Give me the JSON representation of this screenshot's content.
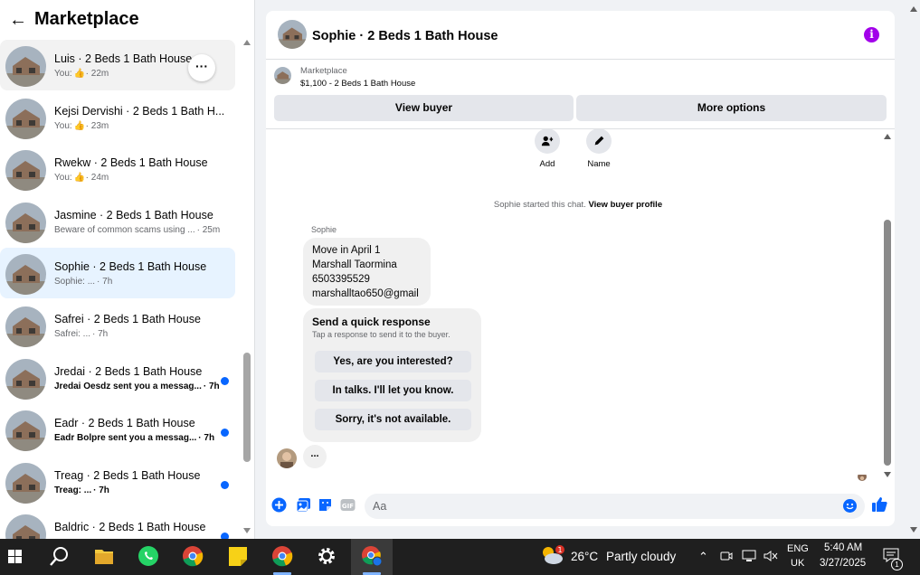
{
  "sidebar": {
    "title": "Marketplace",
    "conversations": [
      {
        "title": "Luis · 2 Beds 1 Bath House",
        "prefix": "You:",
        "thumb": true,
        "time": "· 22m",
        "state": "hover",
        "unread": false
      },
      {
        "title": "Kejsi Dervishi · 2 Beds 1 Bath H...",
        "prefix": "You:",
        "thumb": true,
        "time": "· 23m",
        "state": "",
        "unread": false
      },
      {
        "title": "Rwekw · 2 Beds 1 Bath House",
        "prefix": "You:",
        "thumb": true,
        "time": "· 24m",
        "state": "",
        "unread": false
      },
      {
        "title": "Jasmine · 2 Beds 1 Bath House",
        "prefix": "Beware of common scams using ...",
        "thumb": false,
        "time": "· 25m",
        "state": "",
        "unread": false
      },
      {
        "title": "Sophie · 2 Beds 1 Bath House",
        "prefix": "Sophie: ...",
        "thumb": false,
        "time": "· 7h",
        "state": "active",
        "unread": false
      },
      {
        "title": "Safrei · 2 Beds 1 Bath House",
        "prefix": "Safrei: ...",
        "thumb": false,
        "time": "· 7h",
        "state": "",
        "unread": false
      },
      {
        "title": "Jredai · 2 Beds 1 Bath House",
        "prefix": "Jredai Oesdz sent you a messag...",
        "thumb": false,
        "time": "· 7h",
        "state": "",
        "unread": true
      },
      {
        "title": "Eadr · 2 Beds 1 Bath House",
        "prefix": "Eadr Bolpre sent you a messag...",
        "thumb": false,
        "time": "· 7h",
        "state": "",
        "unread": true
      },
      {
        "title": "Treag · 2 Beds 1 Bath House",
        "prefix": "Treag: ...",
        "thumb": false,
        "time": "· 7h",
        "state": "",
        "unread": true
      },
      {
        "title": "Baldric · 2 Beds 1 Bath House",
        "prefix": "",
        "thumb": false,
        "time": "",
        "state": "",
        "unread": true
      }
    ]
  },
  "chat": {
    "title": "Sophie · 2 Beds 1 Bath House",
    "listing_label": "Marketplace",
    "listing_price": "$1,100 - 2 Beds 1 Bath House",
    "view_buyer": "View buyer",
    "more_options": "More options",
    "actions": {
      "add": "Add",
      "name": "Name"
    },
    "started_text": "Sophie started this chat.",
    "started_link": "View buyer profile",
    "sender": "Sophie",
    "message_lines": [
      "Move in April 1",
      "Marshall  Taormina",
      "6503395529",
      "marshalltao650@gmail"
    ],
    "quick": {
      "title": "Send a quick response",
      "subtitle": "Tap a response to send it to the buyer.",
      "options": [
        "Yes, are you interested?",
        "In talks. I'll let you know.",
        "Sorry, it's not available."
      ]
    },
    "typing": "...",
    "input_placeholder": "Aa"
  },
  "taskbar": {
    "temperature": "26°C",
    "weather": "Partly cloudy",
    "weather_badge": "1",
    "lang": "ENG",
    "region": "UK",
    "time": "5:40 AM",
    "date": "3/27/2025",
    "notifications": "1"
  },
  "colors": {
    "accent": "#0866ff",
    "info": "#a200ea",
    "active_row": "#e7f3ff"
  }
}
